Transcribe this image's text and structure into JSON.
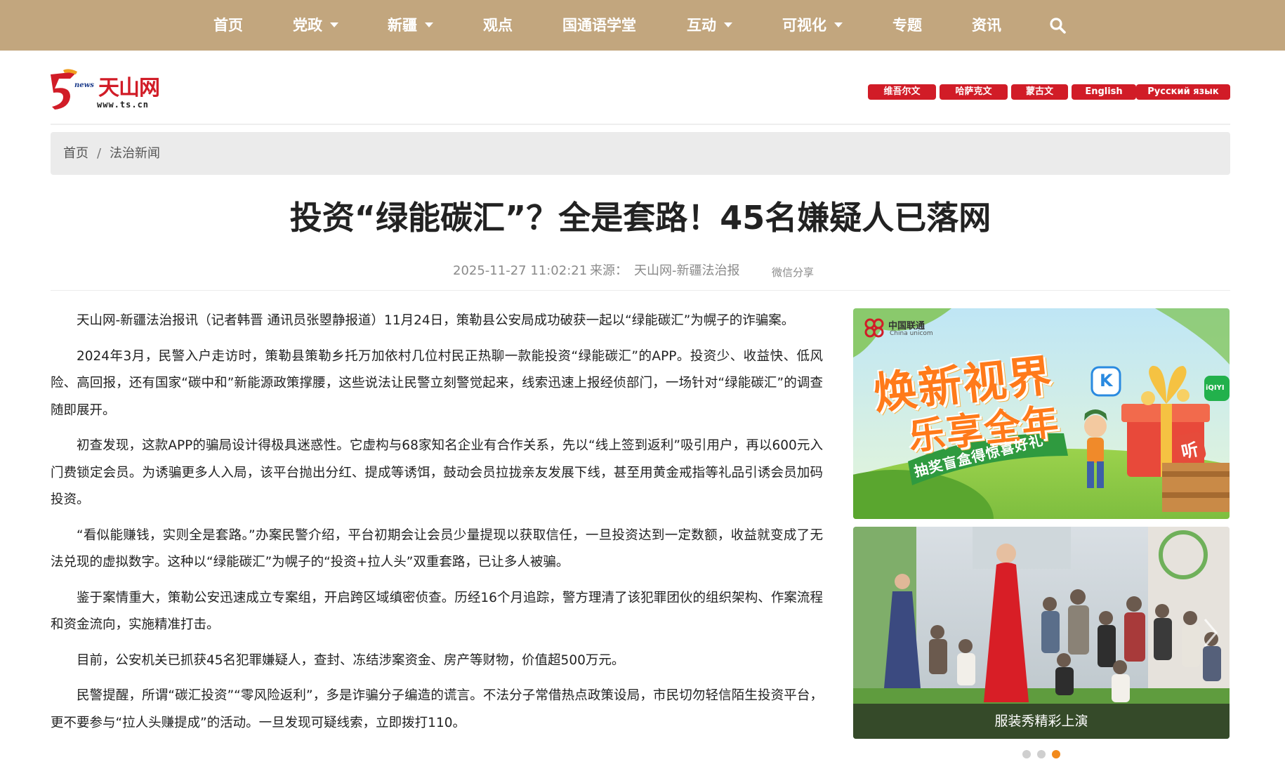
{
  "nav": {
    "items": [
      {
        "label": "首页",
        "dropdown": false
      },
      {
        "label": "党政",
        "dropdown": true
      },
      {
        "label": "新疆",
        "dropdown": true
      },
      {
        "label": "观点",
        "dropdown": false
      },
      {
        "label": "国通语学堂",
        "dropdown": false
      },
      {
        "label": "互动",
        "dropdown": true
      },
      {
        "label": "可视化",
        "dropdown": true
      },
      {
        "label": "专题",
        "dropdown": false
      },
      {
        "label": "资讯",
        "dropdown": false
      }
    ],
    "search_icon": "search-icon",
    "bg_color": "#c2a67e"
  },
  "header": {
    "logo_name": "天山网",
    "logo_tag": "news",
    "logo_url": "www.ts.cn",
    "languages": [
      "维吾尔文",
      "哈萨克文",
      "蒙古文",
      "English",
      "Русский язык"
    ],
    "lang_color": "#d11c27"
  },
  "breadcrumb": {
    "home": "首页",
    "separator": "/",
    "current": "法治新闻"
  },
  "article": {
    "title": "投资“绿能碳汇”？全是套路！45名嫌疑人已落网",
    "datetime": "2025-11-27 11:02:21",
    "source_label": "来源：",
    "source": "天山网-新疆法治报",
    "share": "微信分享",
    "paragraphs": [
      "天山网-新疆法治报讯（记者韩晋 通讯员张曌静报道）11月24日，策勒县公安局成功破获一起以“绿能碳汇”为幌子的诈骗案。",
      "2024年3月，民警入户走访时，策勒县策勒乡托万加依村几位村民正热聊一款能投资“绿能碳汇”的APP。投资少、收益快、低风险、高回报，还有国家“碳中和”新能源政策撑腰，这些说法让民警立刻警觉起来，线索迅速上报经侦部门，一场针对“绿能碳汇”的调查随即展开。",
      "初查发现，这款APP的骗局设计得极具迷惑性。它虚构与68家知名企业有合作关系，先以“线上签到返利”吸引用户，再以600元入门费锁定会员。为诱骗更多人入局，该平台抛出分红、提成等诱饵，鼓动会员拉拢亲友发展下线，甚至用黄金戒指等礼品引诱会员加码投资。",
      "“看似能赚钱，实则全是套路。”办案民警介绍，平台初期会让会员少量提现以获取信任，一旦投资达到一定数额，收益就变成了无法兑现的虚拟数字。这种以“绿能碳汇”为幌子的“投资+拉人头”双重套路，已让多人被骗。",
      "鉴于案情重大，策勒公安迅速成立专案组，开启跨区域缜密侦查。历经16个月追踪，警方理清了该犯罪团伙的组织架构、作案流程和资金流向，实施精准打击。",
      "目前，公安机关已抓获45名犯罪嫌疑人，查封、冻结涉案资金、房产等财物，价值超500万元。",
      "民警提醒，所谓“碳汇投资”“零风险返利”，多是诈骗分子编造的谎言。不法分子常借热点政策设局，市民切勿轻信陌生投资平台，更不要参与“拉人头赚提成”的活动。一旦发现可疑线索，立即拨打110。"
    ]
  },
  "sidebar": {
    "ad1": {
      "brand": "中国联通",
      "brand_sub": "China unicom",
      "headline_1": "焕新视界",
      "headline_2": "乐享全年",
      "ribbon": "抽奖盲盒得惊喜好礼",
      "badge_k": "K",
      "badge_iqiyi": "iQIYI",
      "badge_listen": "听"
    },
    "ad2": {
      "caption": "服装秀精彩上演"
    },
    "carousel": {
      "count": 3,
      "active_index": 2
    },
    "accent_color": "#f28a1c"
  }
}
